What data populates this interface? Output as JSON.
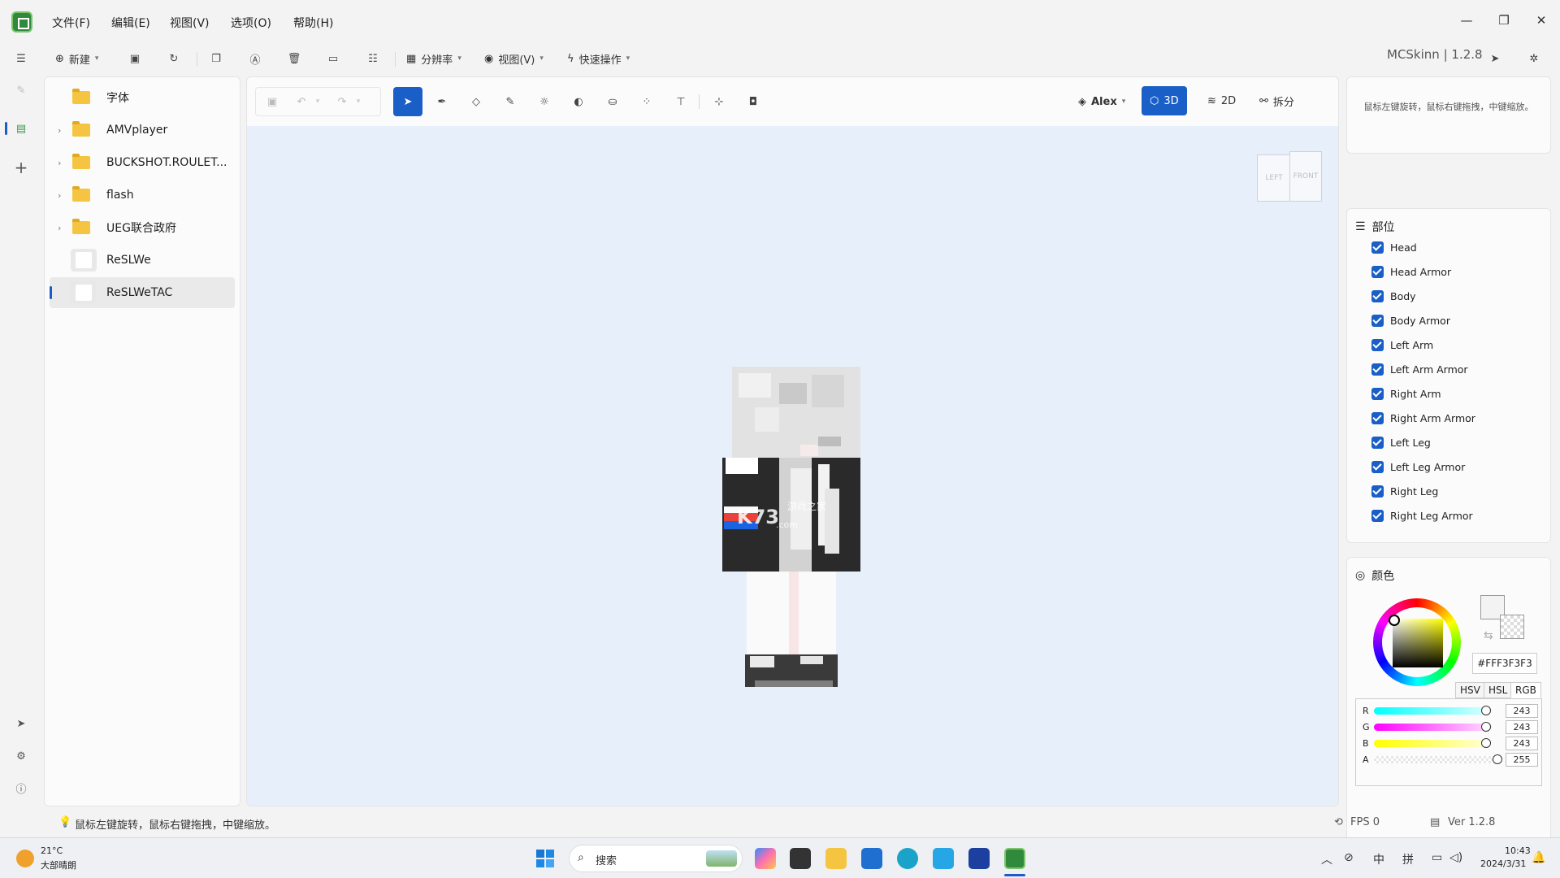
{
  "menu": {
    "items": [
      "文件(F)",
      "编辑(E)",
      "视图(V)",
      "选项(O)",
      "帮助(H)"
    ]
  },
  "toolbar": {
    "new_label": "新建",
    "resolution_label": "分辨率",
    "view_label": "视图(V)",
    "quick_label": "快速操作"
  },
  "app": {
    "name": "MCSkinn",
    "version": "1.2.8"
  },
  "files": [
    {
      "name": "字体",
      "type": "folder",
      "expandable": false
    },
    {
      "name": "AMVplayer",
      "type": "folder",
      "expandable": true
    },
    {
      "name": "BUCKSHOT.ROULET...",
      "type": "folder",
      "expandable": true
    },
    {
      "name": "flash",
      "type": "folder",
      "expandable": true
    },
    {
      "name": "UEG联合政府",
      "type": "folder",
      "expandable": true
    },
    {
      "name": "ReSLWe",
      "type": "skin",
      "expandable": false
    },
    {
      "name": "ReSLWeTAC",
      "type": "skin",
      "expandable": false,
      "selected": true
    }
  ],
  "editor": {
    "model": "Alex",
    "mode_3d": "3D",
    "mode_2d": "2D",
    "split": "拆分",
    "cube_left": "LEFT",
    "cube_front": "FRONT",
    "watermark": "K73",
    "watermark_sub": ".com",
    "watermark_cn": "游戏之家"
  },
  "rightpanel": {
    "hint": "鼠标左键旋转，鼠标右键拖拽，中键缩放。",
    "parts_title": "部位",
    "parts": [
      "Head",
      "Head Armor",
      "Body",
      "Body Armor",
      "Left Arm",
      "Left Arm Armor",
      "Right Arm",
      "Right Arm Armor",
      "Left Leg",
      "Left Leg Armor",
      "Right Leg",
      "Right Leg Armor"
    ],
    "color_title": "颜色",
    "hex": "#FFF3F3F3",
    "modes": [
      "HSV",
      "HSL",
      "RGB"
    ],
    "active_mode": "RGB",
    "channels": [
      {
        "label": "R",
        "value": "243",
        "level": 0.953
      },
      {
        "label": "G",
        "value": "243",
        "level": 0.953
      },
      {
        "label": "B",
        "value": "243",
        "level": 0.953
      },
      {
        "label": "A",
        "value": "255",
        "level": 1.0
      }
    ]
  },
  "status": {
    "hint": "鼠标左键旋转，鼠标右键拖拽，中键缩放。",
    "fps": "FPS 0",
    "ver": "Ver 1.2.8"
  },
  "taskbar": {
    "temp": "21°C",
    "weather": "大部晴朗",
    "search": "搜索",
    "ime1": "中",
    "ime2": "拼",
    "time": "10:43",
    "date": "2024/3/31"
  }
}
